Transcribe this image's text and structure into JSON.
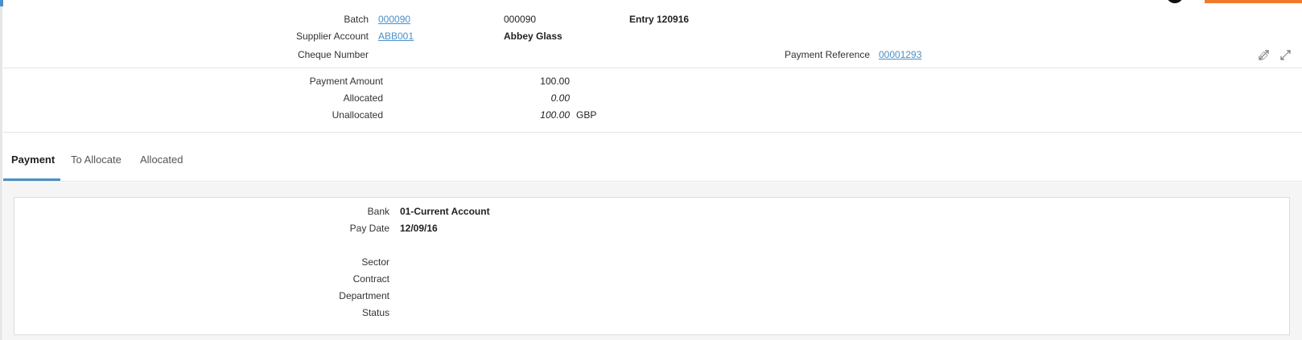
{
  "header": {
    "batch_label": "Batch",
    "batch_link": "000090",
    "batch_value": "000090",
    "entry_text": "Entry 120916",
    "supplier_account_label": "Supplier Account",
    "supplier_account_link": "ABB001",
    "supplier_name": "Abbey Glass",
    "cheque_number_label": "Cheque Number",
    "payment_reference_label": "Payment Reference",
    "payment_reference_link": "00001293"
  },
  "summary": {
    "payment_amount_label": "Payment Amount",
    "payment_amount_value": "100.00",
    "allocated_label": "Allocated",
    "allocated_value": "0.00",
    "unallocated_label": "Unallocated",
    "unallocated_value": "100.00",
    "currency": "GBP"
  },
  "tabs": [
    {
      "label": "Payment",
      "active": true
    },
    {
      "label": "To Allocate",
      "active": false
    },
    {
      "label": "Allocated",
      "active": false
    }
  ],
  "payment_panel": {
    "bank_label": "Bank",
    "bank_value": "01-Current Account",
    "pay_date_label": "Pay Date",
    "pay_date_value": "12/09/16",
    "sector_label": "Sector",
    "contract_label": "Contract",
    "department_label": "Department",
    "status_label": "Status"
  },
  "icons": {
    "expand_1": "expand-icon",
    "expand_2": "expand-icon"
  },
  "colors": {
    "link": "#4a90c9",
    "accent_orange": "#f07b2f",
    "tab_underline": "#4a90c9"
  }
}
